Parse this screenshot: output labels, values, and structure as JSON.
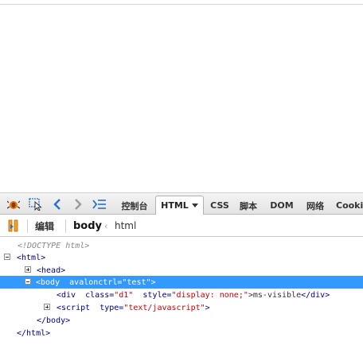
{
  "toolbar": {
    "icons": {
      "firebug": "firebug-bug-icon",
      "inspect": "inspect-element-icon",
      "back": "back-arrow-icon",
      "forward": "forward-arrow-icon",
      "command": "command-line-icon"
    },
    "tabs": [
      {
        "label": "控制台",
        "active": false
      },
      {
        "label": "HTML",
        "active": true
      },
      {
        "label": "CSS",
        "active": false
      },
      {
        "label": "脚本",
        "active": false
      },
      {
        "label": "DOM",
        "active": false
      },
      {
        "label": "网络",
        "active": false
      },
      {
        "label": "Cookie",
        "active": false
      }
    ]
  },
  "subbar": {
    "edit_label": "编辑",
    "breadcrumb": [
      {
        "label": "body"
      },
      {
        "label": "html"
      }
    ]
  },
  "tree": {
    "doctype": "<!DOCTYPE html>",
    "html_open": "<html>",
    "head_tag": "<head>",
    "body_open_tag": "<body",
    "body_attr_name": "avalonctrl=",
    "body_attr_value": "\"test\"",
    "body_open_close": ">",
    "div_open": "<div",
    "div_class_name": "class=",
    "div_class_value": "\"d1\"",
    "div_style_name": "style=",
    "div_style_value": "\"display: none;\"",
    "div_text": ">ms-visible",
    "div_close": "</div>",
    "script_open": "<script",
    "script_type_name": "type=",
    "script_type_value": "\"text/javascript\"",
    "script_close": ">",
    "body_close": "</body>",
    "html_close": "</html>"
  },
  "colors": {
    "selection": "#3399ff",
    "tag": "#000088",
    "attr_value": "#cc0000"
  }
}
